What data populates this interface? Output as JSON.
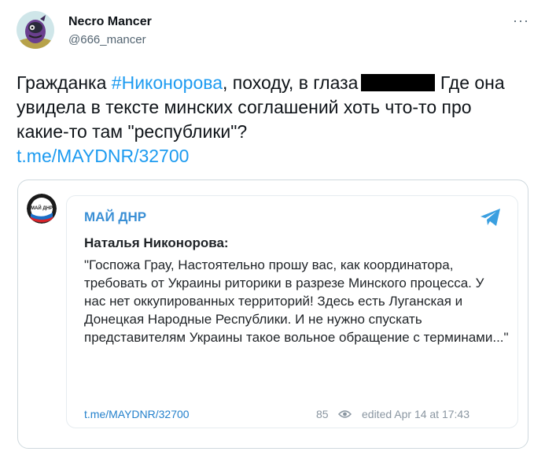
{
  "tweet": {
    "display_name": "Necro Mancer",
    "handle": "@666_mancer",
    "text_part1": "Гражданка ",
    "hashtag": "#Никонорова",
    "text_part2": ", походу, в глаза",
    "text_part3": " Где она увидела в тексте минских соглашений хоть что-то про какие-то там \"республики\"?",
    "link": "t.me/MAYDNR/32700",
    "more_label": "···"
  },
  "telegram_card": {
    "channel_name": "МАЙ ДНР",
    "channel_avatar_text": "МАЙ ДНР",
    "author": "Наталья Никонорова:",
    "quote_part1": "\"Госпожа Грау, Настоятельно прошу вас, как координатора, требовать от Украины риторики в разрезе Минского процесса. У нас нет оккупированных территорий! ",
    "quote_struck": "Здесь есть Луганская и Донецкая Народные Республики",
    "quote_part2": ". И не нужно спускать представителям Украины такое вольное обращение с терминами...\"",
    "link": "t.me/MAYDNR/32700",
    "views": "85",
    "edited": "edited  Apr 14 at 17:43"
  },
  "colors": {
    "link_blue": "#1d9bf0",
    "telegram_blue": "#3a8fd5",
    "strike_red": "#e0282e"
  },
  "icons": [
    "more-icon",
    "telegram-plane-icon",
    "eye-icon"
  ]
}
